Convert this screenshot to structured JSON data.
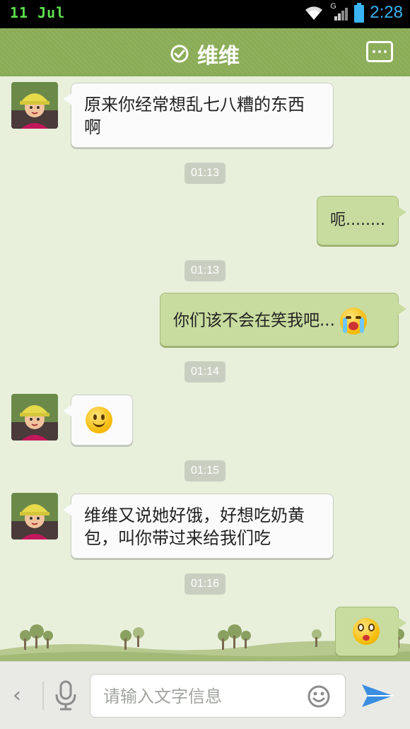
{
  "status_bar": {
    "left_text": "11 Jul",
    "network_label": "G",
    "time": "2:28"
  },
  "header": {
    "title": "维维",
    "verified_icon": "check-circle-icon",
    "menu_icon": "ellipsis-icon"
  },
  "messages": [
    {
      "side": "in",
      "text": "原来你经常想乱七八糟的东西啊"
    },
    {
      "side": "timestamp",
      "text": "01:13"
    },
    {
      "side": "out",
      "text": "呃........"
    },
    {
      "side": "timestamp",
      "text": "01:13"
    },
    {
      "side": "out",
      "text": "你们该不会在笑我吧...",
      "emoji": "crying-face"
    },
    {
      "side": "timestamp",
      "text": "01:14"
    },
    {
      "side": "in",
      "emoji": "smiling-face"
    },
    {
      "side": "timestamp",
      "text": "01:15"
    },
    {
      "side": "in",
      "text": "维维又说她好饿，好想吃奶黄包，叫你带过来给我们吃"
    },
    {
      "side": "timestamp",
      "text": "01:16"
    },
    {
      "side": "out",
      "emoji": "surprised-face"
    }
  ],
  "input_bar": {
    "placeholder": "请输入文字信息",
    "back_icon": "chevron-left-icon",
    "voice_icon": "microphone-icon",
    "emoji_icon": "smiley-icon",
    "send_icon": "paper-plane-icon"
  },
  "colors": {
    "header_green": "#8aac56",
    "chat_background": "#e8f0dc",
    "outgoing_bubble": "#c8dc9f",
    "incoming_bubble": "#fbfbfb",
    "timestamp_pill": "#c9cfc0",
    "status_time_blue": "#3ab4f2"
  }
}
